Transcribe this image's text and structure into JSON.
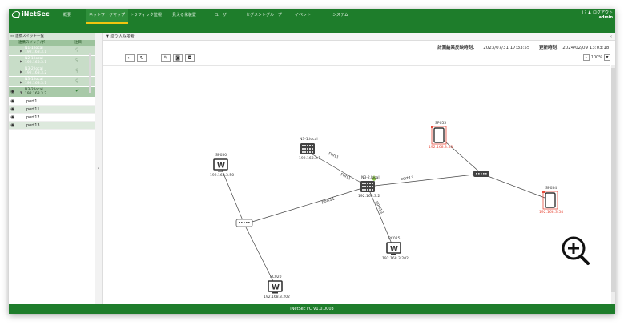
{
  "app": {
    "logo": "iNetSec",
    "footer": "iNetSec FC V1.0.0003"
  },
  "nav": {
    "items": [
      "概要",
      "ネットワークマップ",
      "トラフィック監視",
      "見える化装置",
      "ユーザー",
      "セグメントグループ",
      "イベント",
      "システム"
    ],
    "active_index": 1
  },
  "user": {
    "icons": "i ? ♟",
    "logout": "ログアウト",
    "name": "admin"
  },
  "sidebar": {
    "title": "連携スイッチ一覧",
    "col_port": "連携スイッチ/ポート",
    "col_watch": "注目",
    "switches": [
      {
        "name": "N1-1.local",
        "ip": "192.168.3.1"
      },
      {
        "name": "N2-1.local",
        "ip": "192.168.3.1"
      },
      {
        "name": "N3-2.local",
        "ip": "192.168.3.2"
      },
      {
        "name": "N3-1.local",
        "ip": "192.168.3.1"
      },
      {
        "name": "N3-2.local",
        "ip": "192.168.3.2"
      }
    ],
    "ports": [
      "port1",
      "port11",
      "port12",
      "port13"
    ]
  },
  "filter": {
    "label": "絞り込み検索"
  },
  "measurement": {
    "label": "計測結果反映時刻：",
    "time": "2023/07/31 17:33:55",
    "update_label": "更新時刻：",
    "update_time": "2024/02/09 13:03:18"
  },
  "zoom": {
    "minus": "-",
    "level": "100%",
    "plus": "+"
  },
  "map": {
    "nodes": [
      {
        "id": "n31",
        "type": "switch",
        "label": "N3-1.local",
        "ip": "192.168.3.1"
      },
      {
        "id": "n32",
        "type": "switch",
        "label": "N3-2.local",
        "ip": "192.168.3.2"
      },
      {
        "id": "sp050",
        "type": "pc",
        "label": "SP050",
        "ip": "192.168.3.50"
      },
      {
        "id": "pd5",
        "type": "tablet",
        "label": "SP055",
        "ip": "192.168.3.55"
      },
      {
        "id": "pd4",
        "type": "tablet",
        "label": "SP054",
        "ip": "192.168.3.54"
      },
      {
        "id": "pc25",
        "type": "pc",
        "label": "PC025",
        "ip": "192.168.3.202"
      },
      {
        "id": "pc20",
        "type": "pc",
        "label": "PC020",
        "ip": "192.168.3.202"
      }
    ],
    "link_labels": [
      "port1",
      "port1",
      "port13",
      "port11",
      "port13"
    ]
  },
  "colors": {
    "brand": "#1e7d2b",
    "accent": "#f1c40f",
    "alert": "#e74c3c"
  }
}
